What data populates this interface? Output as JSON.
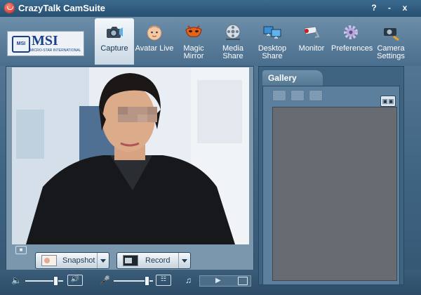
{
  "window": {
    "title": "CrazyTalk CamSuite",
    "controls": [
      "?",
      "-",
      "x"
    ]
  },
  "brand": {
    "name": "MSI",
    "seal": "MSI",
    "subtitle": "MICRO-STAR INTERNATIONAL"
  },
  "tabs": [
    {
      "id": "capture",
      "label": "Capture",
      "icon": "camera-icon",
      "active": true
    },
    {
      "id": "avatar-live",
      "label": "Avatar Live",
      "icon": "baby-face-icon"
    },
    {
      "id": "magic-mirror",
      "label": "Magic Mirror",
      "icon": "mask-icon"
    },
    {
      "id": "media-share",
      "label": "Media Share",
      "icon": "film-reel-icon"
    },
    {
      "id": "desktop-share",
      "label": "Desktop Share",
      "icon": "monitors-icon"
    },
    {
      "id": "monitor",
      "label": "Monitor",
      "icon": "security-camera-icon"
    },
    {
      "id": "preferences",
      "label": "Preferences",
      "icon": "gear-icon"
    },
    {
      "id": "camera-settings",
      "label": "Camera Settings",
      "icon": "camera-wrench-icon"
    }
  ],
  "capture": {
    "snapshot_label": "Snapshot",
    "record_label": "Record"
  },
  "gallery": {
    "title": "Gallery"
  },
  "colors": {
    "title_bar": "#2f5b7f",
    "accent": "#c8201a",
    "active_tab": "#e7eff6"
  }
}
